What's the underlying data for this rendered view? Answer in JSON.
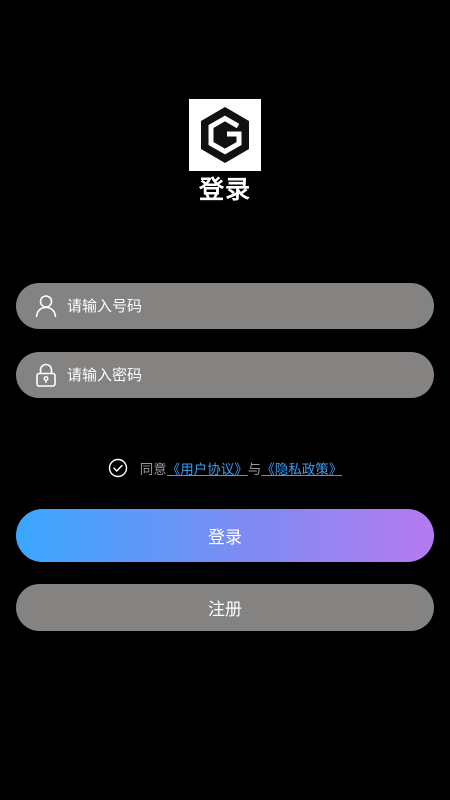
{
  "app": {
    "title": "登录",
    "logo_icon": "hexagon-g-logo"
  },
  "form": {
    "phone": {
      "icon": "user-icon",
      "placeholder": "请输入号码",
      "value": ""
    },
    "password": {
      "icon": "lock-icon",
      "placeholder": "请输入密码",
      "value": ""
    }
  },
  "agreement": {
    "checked": true,
    "prefix": "同意",
    "user_agreement": "《用户协议》",
    "conjunction": "与",
    "privacy_policy": "《隐私政策》"
  },
  "buttons": {
    "login_label": "登录",
    "register_label": "注册"
  },
  "colors": {
    "background": "#000000",
    "field": "#858282",
    "link": "#3f9af0",
    "gradient_start": "#3aa7ff",
    "gradient_end": "#b67af0"
  }
}
